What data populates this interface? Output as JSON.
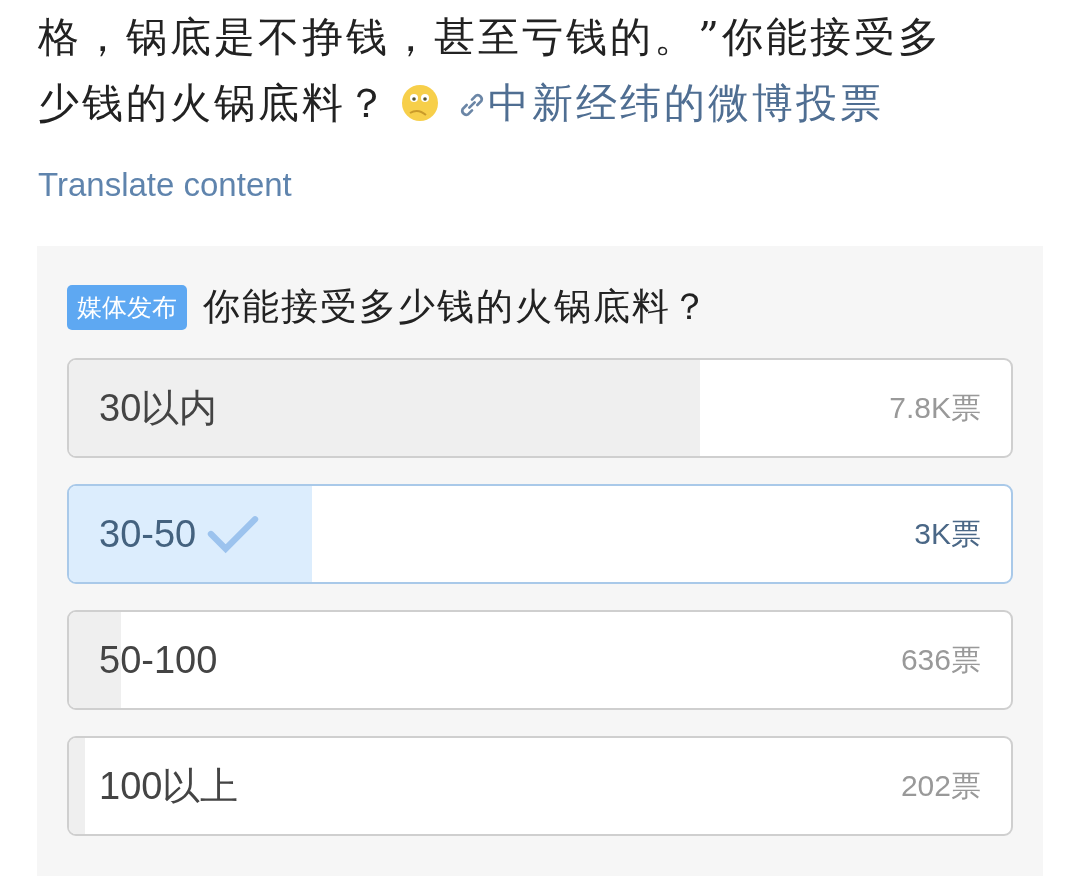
{
  "post": {
    "text": "格，锅底是不挣钱，甚至亏钱的。”你能接受多少钱的火锅底料？",
    "link": "中新经纬的微博投票",
    "translate": "Translate content"
  },
  "poll": {
    "badge": "媒体发布",
    "question": "你能接受多少钱的火锅底料？",
    "options": [
      {
        "label": "30以内",
        "count": "7.8K票",
        "level": 0.67,
        "selected": false
      },
      {
        "label": "30-50",
        "count": "3K票",
        "level": 0.258,
        "selected": true
      },
      {
        "label": "50-100",
        "count": "636票",
        "level": 0.055,
        "selected": false
      },
      {
        "label": "100以上",
        "count": "202票",
        "level": 0.017,
        "selected": false
      }
    ]
  }
}
